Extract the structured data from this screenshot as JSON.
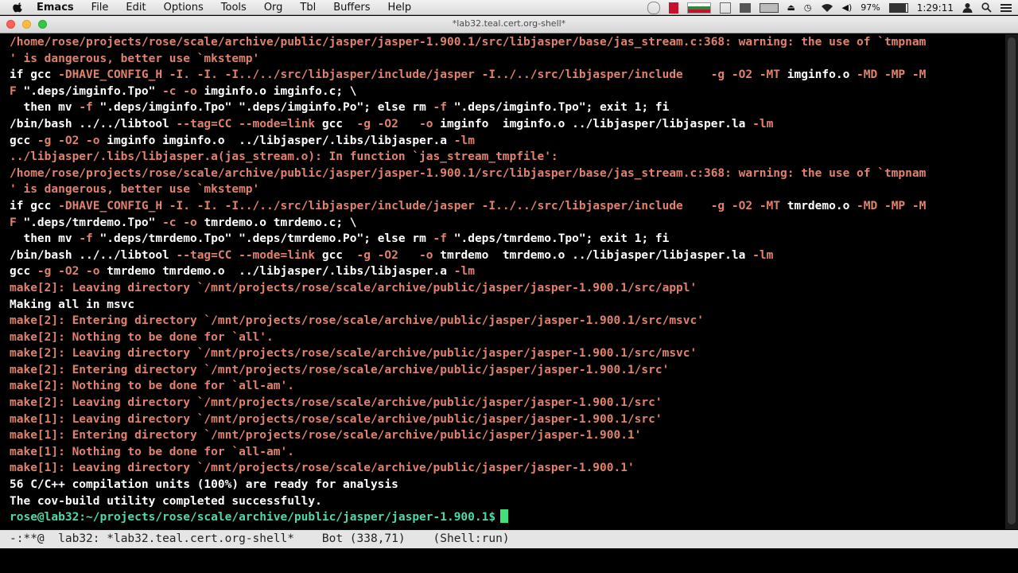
{
  "menubar": {
    "app_name": "Emacs",
    "items": [
      "File",
      "Edit",
      "Options",
      "Tools",
      "Org",
      "Tbl",
      "Buffers",
      "Help"
    ],
    "battery": "97%",
    "clock": "1:29:11"
  },
  "window": {
    "title": "*lab32.teal.cert.org-shell*"
  },
  "terminal": {
    "lines": [
      [
        [
          "o",
          "/home/rose/projects/rose/scale/archive/public/jasper/jasper-1.900.1/src/libjasper/base/jas_stream.c:368: warning: the use of `tmpnam"
        ]
      ],
      [
        [
          "o",
          "' is dangerous, better use `mkstemp'"
        ]
      ],
      [
        [
          "w",
          "if gcc "
        ],
        [
          "o",
          "-DHAVE_CONFIG_H -I. -I. -I../../src/libjasper/include/jasper -I../../src/libjasper/include    -g -O2 -MT "
        ],
        [
          "w",
          "imginfo.o "
        ],
        [
          "o",
          "-MD -MP -M"
        ]
      ],
      [
        [
          "o",
          "F "
        ],
        [
          "w",
          "\".deps/imginfo.Tpo\" "
        ],
        [
          "o",
          "-c -o "
        ],
        [
          "w",
          "imginfo.o imginfo.c; \\"
        ]
      ],
      [
        [
          "w",
          "  then mv "
        ],
        [
          "o",
          "-f "
        ],
        [
          "w",
          "\".deps/imginfo.Tpo\" \".deps/imginfo.Po\"; else rm "
        ],
        [
          "o",
          "-f "
        ],
        [
          "w",
          "\".deps/imginfo.Tpo\"; exit 1; fi"
        ]
      ],
      [
        [
          "w",
          "/bin/bash ../../libtool "
        ],
        [
          "o",
          "--tag=CC --mode=link "
        ],
        [
          "w",
          "gcc  "
        ],
        [
          "o",
          "-g -O2   -o "
        ],
        [
          "w",
          "imginfo  imginfo.o ../libjasper/libjasper.la "
        ],
        [
          "o",
          "-lm"
        ]
      ],
      [
        [
          "w",
          "gcc "
        ],
        [
          "o",
          "-g -O2 -o "
        ],
        [
          "w",
          "imginfo imginfo.o  ../libjasper/.libs/libjasper.a "
        ],
        [
          "o",
          "-lm"
        ]
      ],
      [
        [
          "o",
          "../libjasper/.libs/libjasper.a(jas_stream.o): In function `jas_stream_tmpfile':"
        ]
      ],
      [
        [
          "o",
          "/home/rose/projects/rose/scale/archive/public/jasper/jasper-1.900.1/src/libjasper/base/jas_stream.c:368: warning: the use of `tmpnam"
        ]
      ],
      [
        [
          "o",
          "' is dangerous, better use `mkstemp'"
        ]
      ],
      [
        [
          "w",
          "if gcc "
        ],
        [
          "o",
          "-DHAVE_CONFIG_H -I. -I. -I../../src/libjasper/include/jasper -I../../src/libjasper/include    -g -O2 -MT "
        ],
        [
          "w",
          "tmrdemo.o "
        ],
        [
          "o",
          "-MD -MP -M"
        ]
      ],
      [
        [
          "o",
          "F "
        ],
        [
          "w",
          "\".deps/tmrdemo.Tpo\" "
        ],
        [
          "o",
          "-c -o "
        ],
        [
          "w",
          "tmrdemo.o tmrdemo.c; \\"
        ]
      ],
      [
        [
          "w",
          "  then mv "
        ],
        [
          "o",
          "-f "
        ],
        [
          "w",
          "\".deps/tmrdemo.Tpo\" \".deps/tmrdemo.Po\"; else rm "
        ],
        [
          "o",
          "-f "
        ],
        [
          "w",
          "\".deps/tmrdemo.Tpo\"; exit 1; fi"
        ]
      ],
      [
        [
          "w",
          "/bin/bash ../../libtool "
        ],
        [
          "o",
          "--tag=CC --mode=link "
        ],
        [
          "w",
          "gcc  "
        ],
        [
          "o",
          "-g -O2   -o "
        ],
        [
          "w",
          "tmrdemo  tmrdemo.o ../libjasper/libjasper.la "
        ],
        [
          "o",
          "-lm"
        ]
      ],
      [
        [
          "w",
          "gcc "
        ],
        [
          "o",
          "-g -O2 -o "
        ],
        [
          "w",
          "tmrdemo tmrdemo.o  ../libjasper/.libs/libjasper.a "
        ],
        [
          "o",
          "-lm"
        ]
      ],
      [
        [
          "o",
          "make[2]: Leaving directory `/mnt/projects/rose/scale/archive/public/jasper/jasper-1.900.1/src/appl'"
        ]
      ],
      [
        [
          "w",
          "Making all in msvc"
        ]
      ],
      [
        [
          "o",
          "make[2]: Entering directory `/mnt/projects/rose/scale/archive/public/jasper/jasper-1.900.1/src/msvc'"
        ]
      ],
      [
        [
          "o",
          "make[2]: Nothing to be done for `all'."
        ]
      ],
      [
        [
          "o",
          "make[2]: Leaving directory `/mnt/projects/rose/scale/archive/public/jasper/jasper-1.900.1/src/msvc'"
        ]
      ],
      [
        [
          "o",
          "make[2]: Entering directory `/mnt/projects/rose/scale/archive/public/jasper/jasper-1.900.1/src'"
        ]
      ],
      [
        [
          "o",
          "make[2]: Nothing to be done for `all-am'."
        ]
      ],
      [
        [
          "o",
          "make[2]: Leaving directory `/mnt/projects/rose/scale/archive/public/jasper/jasper-1.900.1/src'"
        ]
      ],
      [
        [
          "o",
          "make[1]: Leaving directory `/mnt/projects/rose/scale/archive/public/jasper/jasper-1.900.1/src'"
        ]
      ],
      [
        [
          "o",
          "make[1]: Entering directory `/mnt/projects/rose/scale/archive/public/jasper/jasper-1.900.1'"
        ]
      ],
      [
        [
          "o",
          "make[1]: Nothing to be done for `all-am'."
        ]
      ],
      [
        [
          "o",
          "make[1]: Leaving directory `/mnt/projects/rose/scale/archive/public/jasper/jasper-1.900.1'"
        ]
      ],
      [
        [
          "w",
          "56 C/C++ compilation units (100%) are ready for analysis"
        ]
      ],
      [
        [
          "w",
          "The cov-build utility completed successfully."
        ]
      ]
    ],
    "prompt": "rose@lab32:~/projects/rose/scale/archive/public/jasper/jasper-1.900.1$"
  },
  "modeline": {
    "status": "-:**@",
    "buffer": "lab32: *lab32.teal.cert.org-shell*",
    "position": "Bot (338,71)",
    "mode": "(Shell:run)"
  },
  "colors": {
    "output": "#e0826d",
    "text": "#ffffff",
    "prompt": "#50d8a8",
    "cursor": "#44e07a"
  }
}
